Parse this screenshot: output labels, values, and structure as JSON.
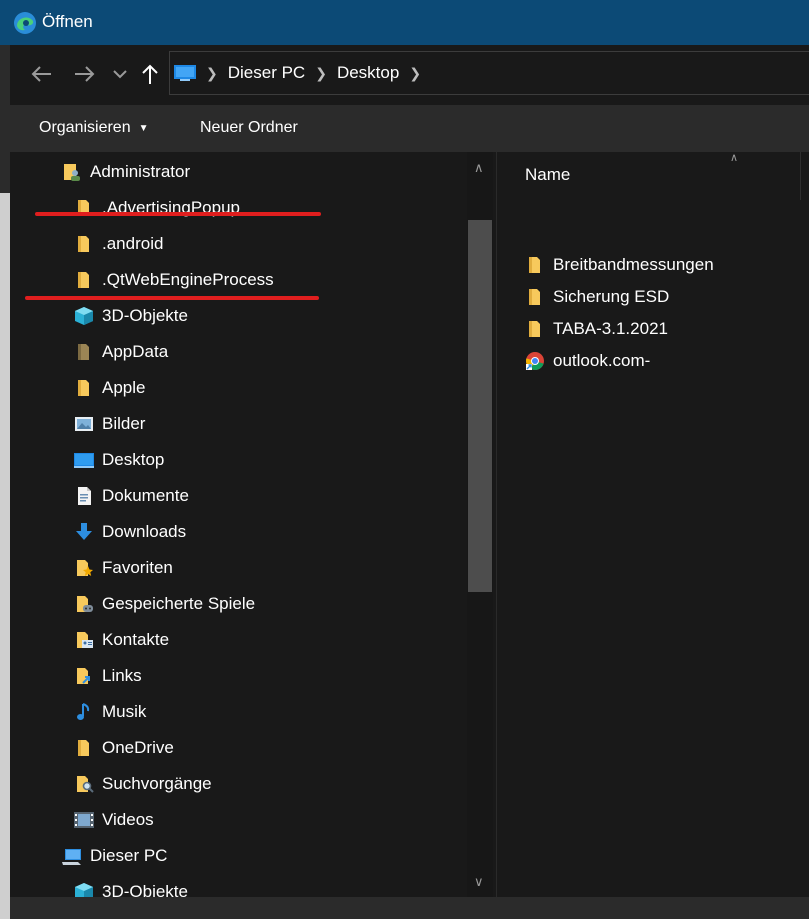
{
  "window": {
    "title": "Öffnen"
  },
  "nav": {
    "back_icon": "arrow-left-icon",
    "forward_icon": "arrow-right-icon",
    "recent_icon": "chevron-down-icon",
    "up_icon": "arrow-up-icon"
  },
  "address": {
    "crumbs": [
      "Dieser PC",
      "Desktop"
    ]
  },
  "toolbar": {
    "organize_label": "Organisieren",
    "new_folder_label": "Neuer Ordner"
  },
  "tree": {
    "items": [
      {
        "label": "Administrator",
        "icon": "user-folder-icon"
      },
      {
        "label": ".AdvertisingPopup",
        "icon": "folder-icon"
      },
      {
        "label": ".android",
        "icon": "folder-icon"
      },
      {
        "label": ".QtWebEngineProcess",
        "icon": "folder-icon"
      },
      {
        "label": "3D-Objekte",
        "icon": "3d-objects-icon"
      },
      {
        "label": "AppData",
        "icon": "hidden-folder-icon"
      },
      {
        "label": "Apple",
        "icon": "folder-icon"
      },
      {
        "label": "Bilder",
        "icon": "pictures-icon"
      },
      {
        "label": "Desktop",
        "icon": "desktop-icon"
      },
      {
        "label": "Dokumente",
        "icon": "documents-icon"
      },
      {
        "label": "Downloads",
        "icon": "downloads-icon"
      },
      {
        "label": "Favoriten",
        "icon": "favorites-icon"
      },
      {
        "label": "Gespeicherte Spiele",
        "icon": "saved-games-icon"
      },
      {
        "label": "Kontakte",
        "icon": "contacts-icon"
      },
      {
        "label": "Links",
        "icon": "links-icon"
      },
      {
        "label": "Musik",
        "icon": "music-icon"
      },
      {
        "label": "OneDrive",
        "icon": "folder-icon"
      },
      {
        "label": "Suchvorgänge",
        "icon": "searches-icon"
      },
      {
        "label": "Videos",
        "icon": "videos-icon"
      },
      {
        "label": "Dieser PC",
        "icon": "this-pc-icon"
      },
      {
        "label": "3D-Objekte",
        "icon": "3d-objects-icon"
      }
    ]
  },
  "files": {
    "column_name": "Name",
    "items": [
      {
        "label": "Breitbandmessungen",
        "icon": "folder-icon"
      },
      {
        "label": "Sicherung ESD",
        "icon": "folder-icon"
      },
      {
        "label": "TABA-3.1.2021",
        "icon": "folder-icon"
      },
      {
        "label": "outlook.com-",
        "icon": "chrome-shortcut-icon"
      }
    ]
  },
  "colors": {
    "titlebar": "#0c4a76",
    "background": "#191919",
    "toolbar": "#2b2b2b",
    "folder": "#f7c95c",
    "annotation": "#e01e1e"
  }
}
